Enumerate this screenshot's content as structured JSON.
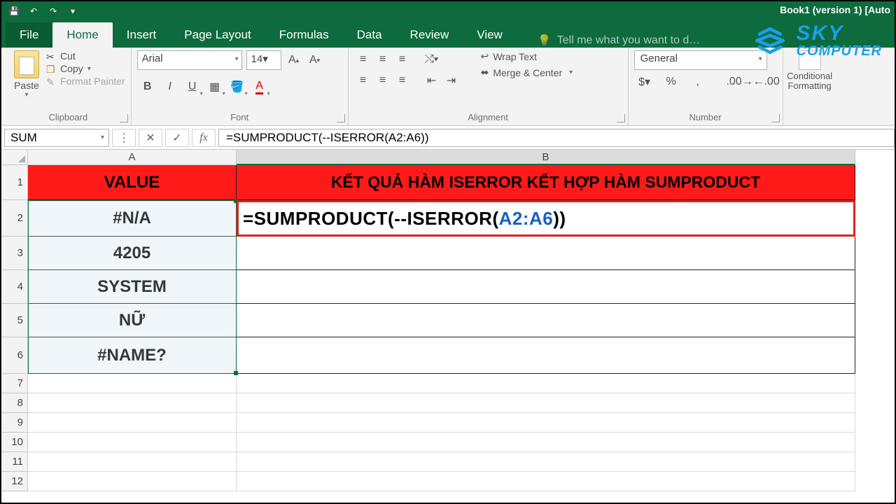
{
  "titlebar": {
    "doc_title": "Book1 (version 1) [Auto"
  },
  "tabs": {
    "file": "File",
    "home": "Home",
    "insert": "Insert",
    "page_layout": "Page Layout",
    "formulas": "Formulas",
    "data": "Data",
    "review": "Review",
    "view": "View",
    "tell_me": "Tell me what you want to d…"
  },
  "ribbon": {
    "clipboard": {
      "label": "Clipboard",
      "paste": "Paste",
      "cut": "Cut",
      "copy": "Copy",
      "format_painter": "Format Painter"
    },
    "font": {
      "label": "Font",
      "name": "Arial",
      "size": "14"
    },
    "alignment": {
      "label": "Alignment",
      "wrap": "Wrap Text",
      "merge": "Merge & Center"
    },
    "number": {
      "label": "Number",
      "format": "General"
    },
    "styles": {
      "cond": "Conditional Formatting"
    }
  },
  "fxbar": {
    "namebox": "SUM",
    "formula": "=SUMPRODUCT(--ISERROR(A2:A6))"
  },
  "columns": {
    "A": "A",
    "B": "B"
  },
  "sheet": {
    "header_a": "VALUE",
    "header_b": "KẾT QUẢ HÀM ISERROR KẾT HỢP HÀM SUMPRODUCT",
    "a2": "#N/A",
    "a3": "4205",
    "a4": "SYSTEM",
    "a5": "NỮ",
    "a6": "#NAME?",
    "b2_formula_pre": "=SUMPRODUCT(--ISERROR(",
    "b2_formula_ref": "A2:A6",
    "b2_formula_post": "))"
  },
  "watermark": {
    "line1": "SKY",
    "line2": "COMPUTER"
  },
  "rows": [
    "1",
    "2",
    "3",
    "4",
    "5",
    "6",
    "7",
    "8",
    "9",
    "10",
    "11",
    "12"
  ],
  "colors": {
    "brand_green": "#0d6b3d",
    "header_red": "#ff1a1a",
    "ref_blue": "#1a5fc2",
    "wm_blue": "#1aa0e8"
  }
}
